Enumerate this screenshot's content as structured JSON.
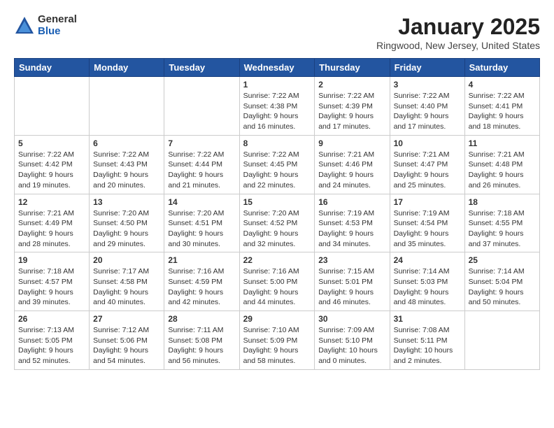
{
  "header": {
    "logo_general": "General",
    "logo_blue": "Blue",
    "month_title": "January 2025",
    "location": "Ringwood, New Jersey, United States"
  },
  "days_of_week": [
    "Sunday",
    "Monday",
    "Tuesday",
    "Wednesday",
    "Thursday",
    "Friday",
    "Saturday"
  ],
  "weeks": [
    [
      {
        "day": "",
        "info": ""
      },
      {
        "day": "",
        "info": ""
      },
      {
        "day": "",
        "info": ""
      },
      {
        "day": "1",
        "info": "Sunrise: 7:22 AM\nSunset: 4:38 PM\nDaylight: 9 hours\nand 16 minutes."
      },
      {
        "day": "2",
        "info": "Sunrise: 7:22 AM\nSunset: 4:39 PM\nDaylight: 9 hours\nand 17 minutes."
      },
      {
        "day": "3",
        "info": "Sunrise: 7:22 AM\nSunset: 4:40 PM\nDaylight: 9 hours\nand 17 minutes."
      },
      {
        "day": "4",
        "info": "Sunrise: 7:22 AM\nSunset: 4:41 PM\nDaylight: 9 hours\nand 18 minutes."
      }
    ],
    [
      {
        "day": "5",
        "info": "Sunrise: 7:22 AM\nSunset: 4:42 PM\nDaylight: 9 hours\nand 19 minutes."
      },
      {
        "day": "6",
        "info": "Sunrise: 7:22 AM\nSunset: 4:43 PM\nDaylight: 9 hours\nand 20 minutes."
      },
      {
        "day": "7",
        "info": "Sunrise: 7:22 AM\nSunset: 4:44 PM\nDaylight: 9 hours\nand 21 minutes."
      },
      {
        "day": "8",
        "info": "Sunrise: 7:22 AM\nSunset: 4:45 PM\nDaylight: 9 hours\nand 22 minutes."
      },
      {
        "day": "9",
        "info": "Sunrise: 7:21 AM\nSunset: 4:46 PM\nDaylight: 9 hours\nand 24 minutes."
      },
      {
        "day": "10",
        "info": "Sunrise: 7:21 AM\nSunset: 4:47 PM\nDaylight: 9 hours\nand 25 minutes."
      },
      {
        "day": "11",
        "info": "Sunrise: 7:21 AM\nSunset: 4:48 PM\nDaylight: 9 hours\nand 26 minutes."
      }
    ],
    [
      {
        "day": "12",
        "info": "Sunrise: 7:21 AM\nSunset: 4:49 PM\nDaylight: 9 hours\nand 28 minutes."
      },
      {
        "day": "13",
        "info": "Sunrise: 7:20 AM\nSunset: 4:50 PM\nDaylight: 9 hours\nand 29 minutes."
      },
      {
        "day": "14",
        "info": "Sunrise: 7:20 AM\nSunset: 4:51 PM\nDaylight: 9 hours\nand 30 minutes."
      },
      {
        "day": "15",
        "info": "Sunrise: 7:20 AM\nSunset: 4:52 PM\nDaylight: 9 hours\nand 32 minutes."
      },
      {
        "day": "16",
        "info": "Sunrise: 7:19 AM\nSunset: 4:53 PM\nDaylight: 9 hours\nand 34 minutes."
      },
      {
        "day": "17",
        "info": "Sunrise: 7:19 AM\nSunset: 4:54 PM\nDaylight: 9 hours\nand 35 minutes."
      },
      {
        "day": "18",
        "info": "Sunrise: 7:18 AM\nSunset: 4:55 PM\nDaylight: 9 hours\nand 37 minutes."
      }
    ],
    [
      {
        "day": "19",
        "info": "Sunrise: 7:18 AM\nSunset: 4:57 PM\nDaylight: 9 hours\nand 39 minutes."
      },
      {
        "day": "20",
        "info": "Sunrise: 7:17 AM\nSunset: 4:58 PM\nDaylight: 9 hours\nand 40 minutes."
      },
      {
        "day": "21",
        "info": "Sunrise: 7:16 AM\nSunset: 4:59 PM\nDaylight: 9 hours\nand 42 minutes."
      },
      {
        "day": "22",
        "info": "Sunrise: 7:16 AM\nSunset: 5:00 PM\nDaylight: 9 hours\nand 44 minutes."
      },
      {
        "day": "23",
        "info": "Sunrise: 7:15 AM\nSunset: 5:01 PM\nDaylight: 9 hours\nand 46 minutes."
      },
      {
        "day": "24",
        "info": "Sunrise: 7:14 AM\nSunset: 5:03 PM\nDaylight: 9 hours\nand 48 minutes."
      },
      {
        "day": "25",
        "info": "Sunrise: 7:14 AM\nSunset: 5:04 PM\nDaylight: 9 hours\nand 50 minutes."
      }
    ],
    [
      {
        "day": "26",
        "info": "Sunrise: 7:13 AM\nSunset: 5:05 PM\nDaylight: 9 hours\nand 52 minutes."
      },
      {
        "day": "27",
        "info": "Sunrise: 7:12 AM\nSunset: 5:06 PM\nDaylight: 9 hours\nand 54 minutes."
      },
      {
        "day": "28",
        "info": "Sunrise: 7:11 AM\nSunset: 5:08 PM\nDaylight: 9 hours\nand 56 minutes."
      },
      {
        "day": "29",
        "info": "Sunrise: 7:10 AM\nSunset: 5:09 PM\nDaylight: 9 hours\nand 58 minutes."
      },
      {
        "day": "30",
        "info": "Sunrise: 7:09 AM\nSunset: 5:10 PM\nDaylight: 10 hours\nand 0 minutes."
      },
      {
        "day": "31",
        "info": "Sunrise: 7:08 AM\nSunset: 5:11 PM\nDaylight: 10 hours\nand 2 minutes."
      },
      {
        "day": "",
        "info": ""
      }
    ]
  ]
}
